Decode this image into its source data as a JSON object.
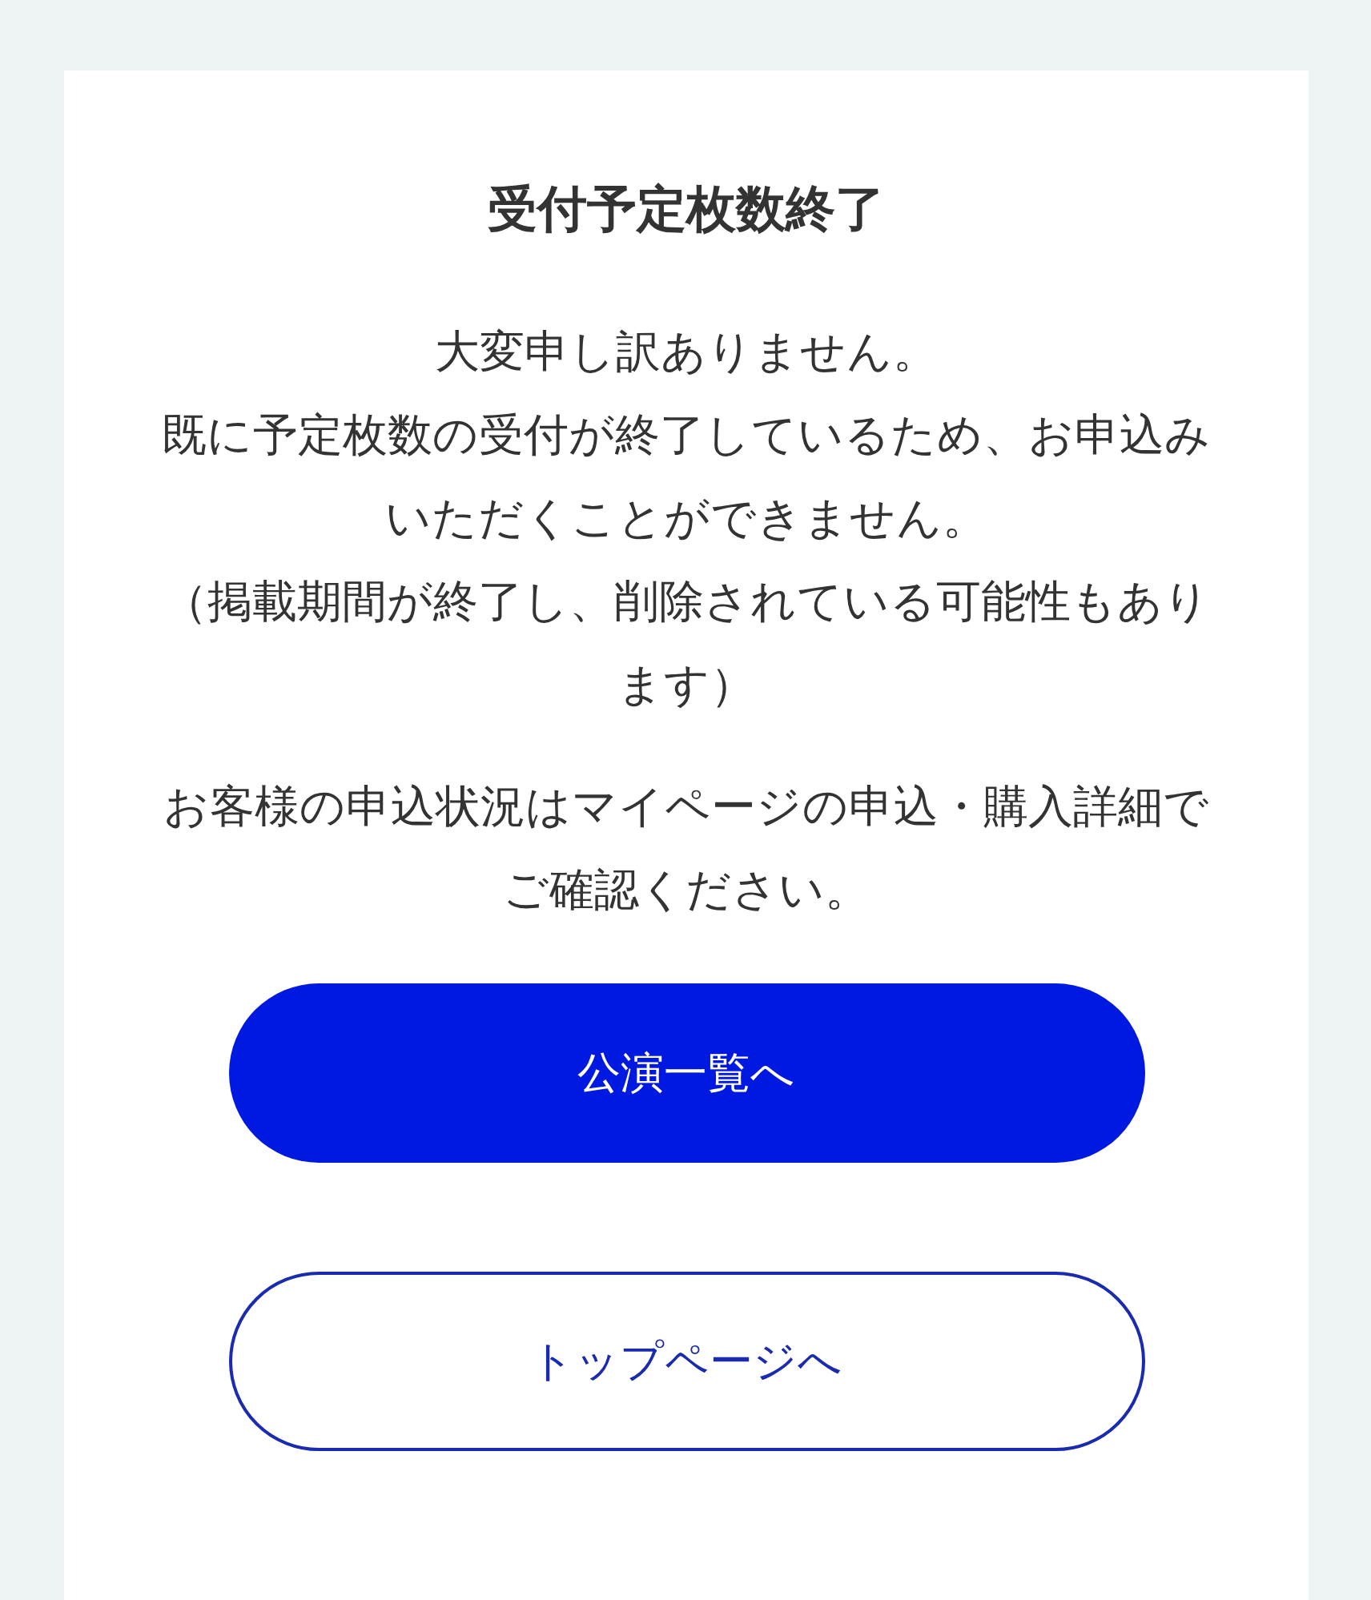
{
  "title": "受付予定枚数終了",
  "paragraphs": [
    {
      "lines": [
        "大変申し訳ありません。",
        "既に予定枚数の受付が終了しているため、お申込み",
        "いただくことができません。",
        "（掲載期間が終了し、削除されている可能性もあり",
        "ます）"
      ]
    },
    {
      "lines": [
        "お客様の申込状況はマイページの申込・購入詳細で",
        "ご確認ください。"
      ]
    }
  ],
  "buttons": [
    {
      "label": "公演一覧へ",
      "kind": "primary"
    },
    {
      "label": "トップページへ",
      "kind": "secondary"
    }
  ]
}
